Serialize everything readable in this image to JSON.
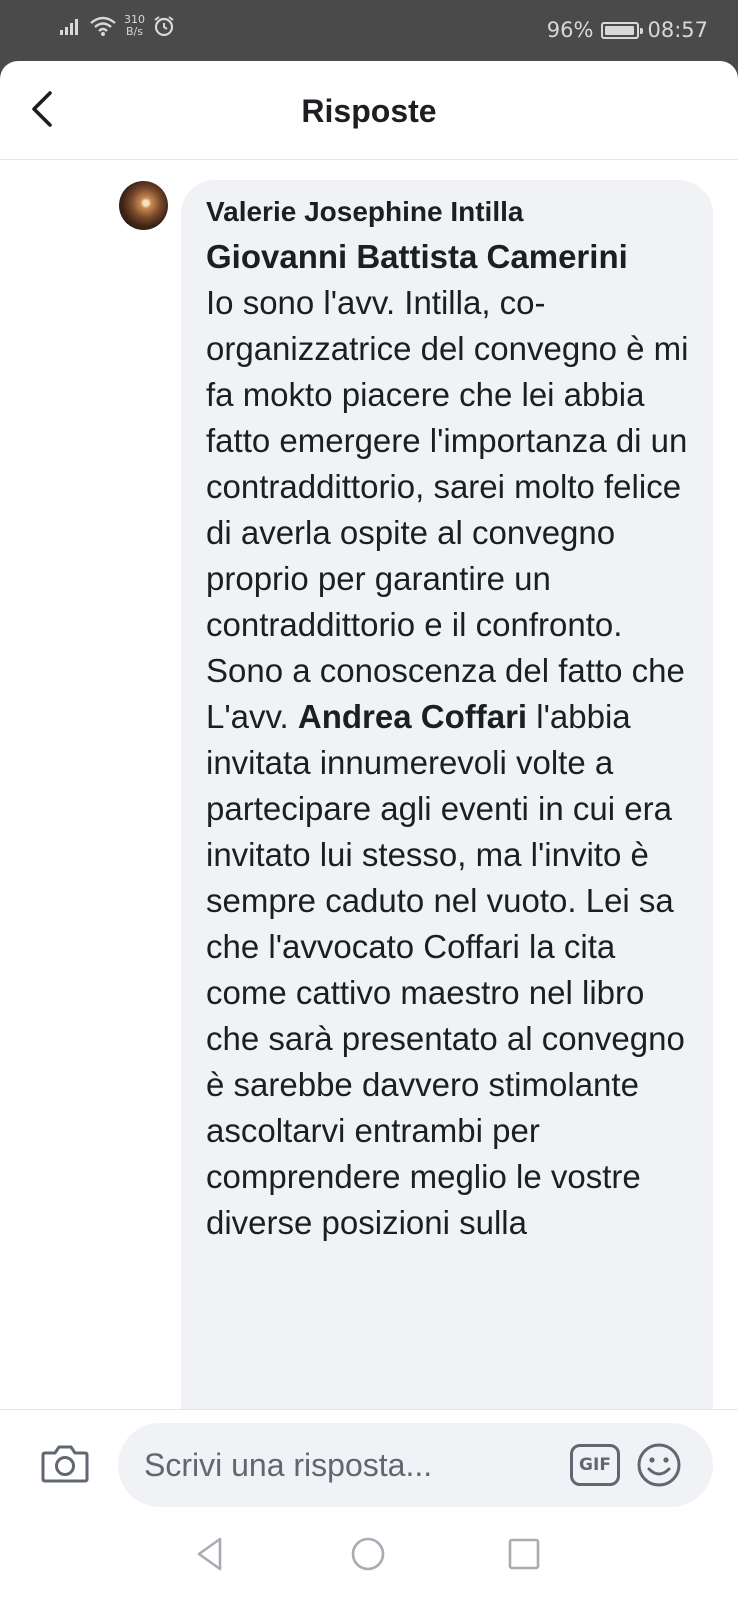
{
  "status_bar": {
    "speed_value": "310",
    "speed_unit": "B/s",
    "battery": "96%",
    "battery_level": 0.96,
    "time": "08:57"
  },
  "header": {
    "title": "Risposte",
    "back_icon": "chevron-left-icon"
  },
  "comment": {
    "author": "Valerie Josephine Intilla",
    "mention_1": "Giovanni Battista Camerini",
    "text_1": "Io sono l'avv. Intilla, co-organizzatrice del convegno è mi fa mokto piacere che lei abbia fatto emergere l'importanza di un contraddittorio, sarei molto felice di averla ospite al convegno proprio per garantire un contraddittorio e il confronto. Sono a conoscenza del fatto che L'avv. ",
    "mention_2": "Andrea Coffari",
    "text_2": " l'abbia invitata innumerevoli volte a partecipare agli eventi in cui era invitato lui stesso, ma l'invito è sempre caduto nel vuoto. Lei sa che l'avvocato Coffari la cita come cattivo maestro nel libro che sarà presentato al convegno è sarebbe davvero stimolante ascoltarvi entrambi per comprendere meglio le vostre diverse posizioni sulla"
  },
  "composer": {
    "placeholder": "Scrivi una risposta...",
    "gif_label": "GIF",
    "camera_icon": "camera-icon",
    "emoji_icon": "smiley-icon"
  },
  "nav_bar": {
    "icons": [
      "back-triangle-icon",
      "home-circle-icon",
      "recents-square-icon"
    ]
  }
}
